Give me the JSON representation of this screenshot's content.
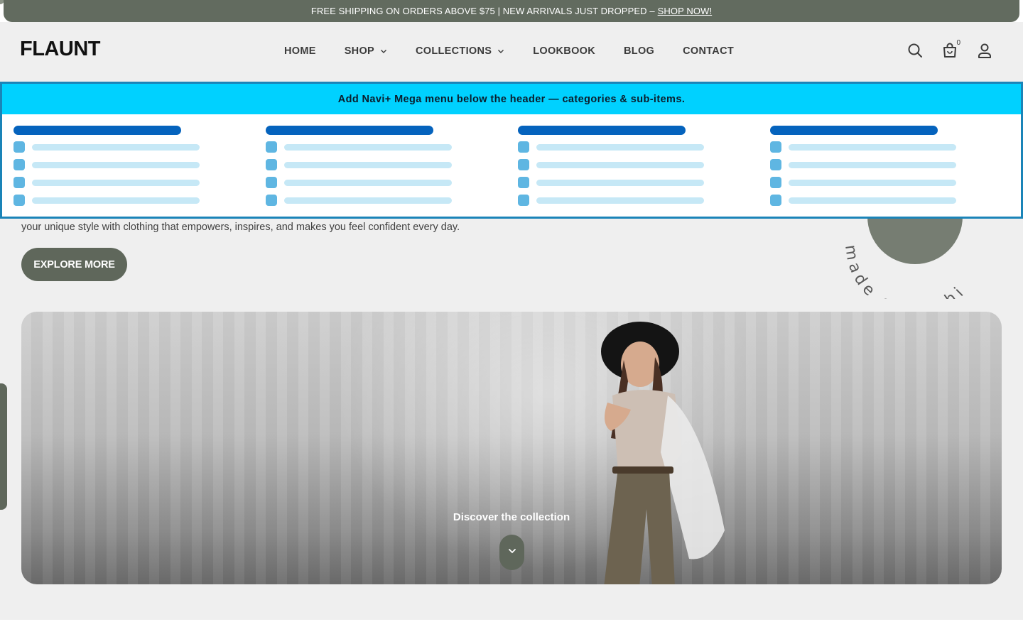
{
  "announcement": {
    "text": "FREE SHIPPING ON ORDERS ABOVE $75 | NEW ARRIVALS JUST DROPPED –",
    "link": "SHOP NOW!"
  },
  "header": {
    "logo": "FLAUNT",
    "nav": [
      {
        "label": "HOME"
      },
      {
        "label": "SHOP"
      },
      {
        "label": "COLLECTIONS"
      },
      {
        "label": "LOOKBOOK"
      },
      {
        "label": "BLOG"
      },
      {
        "label": "CONTACT"
      }
    ],
    "cart_count": "0"
  },
  "mega_menu": {
    "banner": "Add Navi+ Mega menu below the header — categories & sub-items.",
    "columns": 4,
    "items_per_column": 4
  },
  "hero": {
    "text": "your unique style with clothing that empowers, inspires, and makes you feel confident every day.",
    "button": "EXPLORE MORE",
    "badge_text": "made on fashi",
    "discover": "Discover the collection"
  },
  "colors": {
    "announcement_bg": "#626b5f",
    "accent": "#5f675b",
    "mega_banner": "#00d1ff",
    "mega_border": "#1a84b8",
    "placeholder_title": "#0563bd",
    "placeholder_line": "#c6e8f6"
  }
}
